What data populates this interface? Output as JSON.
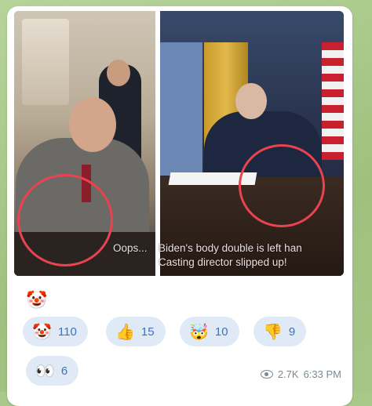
{
  "message": {
    "image_caption_lines": [
      "Oops...",
      "Biden's body double is left han",
      "Casting director slipped up!"
    ],
    "content_emoji": "🤡",
    "reactions": [
      {
        "emoji": "🤡",
        "count": "110"
      },
      {
        "emoji": "👍",
        "count": "15"
      },
      {
        "emoji": "🤯",
        "count": "10"
      },
      {
        "emoji": "👎",
        "count": "9"
      },
      {
        "emoji": "👀",
        "count": "6"
      }
    ],
    "views": "2.7K",
    "time": "6:33 PM"
  },
  "colors": {
    "reaction_bg": "#dfeaf6",
    "reaction_text": "#3f72b8",
    "highlight_circle": "#e8434f",
    "meta_text": "#7a8a96"
  },
  "icons": [
    "eye-icon"
  ]
}
